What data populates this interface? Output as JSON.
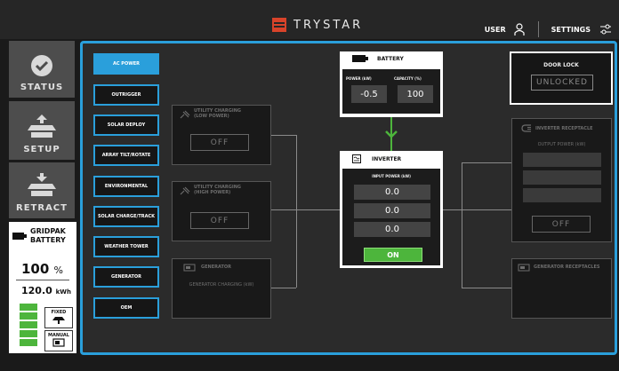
{
  "header": {
    "brand": "TRYSTAR",
    "user_label": "USER",
    "settings_label": "SETTINGS"
  },
  "sidebar": {
    "status_label": "STATUS",
    "setup_label": "SETUP",
    "retract_label": "RETRACT"
  },
  "gridpak": {
    "title_line1": "GRIDPAK",
    "title_line2": "BATTERY",
    "percent": "100",
    "percent_unit": "%",
    "energy": "120.0",
    "energy_unit": "kWh",
    "charge_level_bars": 5,
    "fixed_label": "FIXED",
    "manual_label": "MANUAL"
  },
  "menu": [
    {
      "label": "AC POWER",
      "active": true
    },
    {
      "label": "OUTRIGGER",
      "active": false
    },
    {
      "label": "SOLAR DEPLOY",
      "active": false
    },
    {
      "label": "ARRAY TILT/ROTATE",
      "active": false
    },
    {
      "label": "ENVIRONMENTAL",
      "active": false
    },
    {
      "label": "SOLAR CHARGE/TRACK",
      "active": false
    },
    {
      "label": "WEATHER TOWER",
      "active": false
    },
    {
      "label": "GENERATOR",
      "active": false
    },
    {
      "label": "OEM",
      "active": false
    }
  ],
  "utility_low": {
    "title_line1": "UTILITY CHARGING",
    "title_line2": "(LOW POWER)",
    "button": "OFF"
  },
  "utility_high": {
    "title_line1": "UTILITY CHARGING",
    "title_line2": "(HIGH POWER)",
    "button": "OFF"
  },
  "generator": {
    "title": "GENERATOR",
    "subtitle": "GENERATOR CHARGING (kW)"
  },
  "battery": {
    "title": "BATTERY",
    "power_label": "POWER (kW)",
    "capacity_label": "CAPACITY (%)",
    "power_value": "-0.5",
    "capacity_value": "100"
  },
  "inverter": {
    "title": "INVERTER",
    "input_label": "INPUT POWER (kW)",
    "values": [
      "0.0",
      "0.0",
      "0.0"
    ],
    "button": "ON"
  },
  "door_lock": {
    "title": "DOOR LOCK",
    "button": "UNLOCKED"
  },
  "inverter_receptacle": {
    "title": "INVERTER RECEPTACLE",
    "subtitle": "OUTPUT POWER (kW)",
    "button": "OFF"
  },
  "generator_receptacles": {
    "title": "GENERATOR RECEPTACLES"
  },
  "colors": {
    "accent": "#2a9fdb",
    "on_green": "#4db53c",
    "brand_red": "#d8432a"
  }
}
